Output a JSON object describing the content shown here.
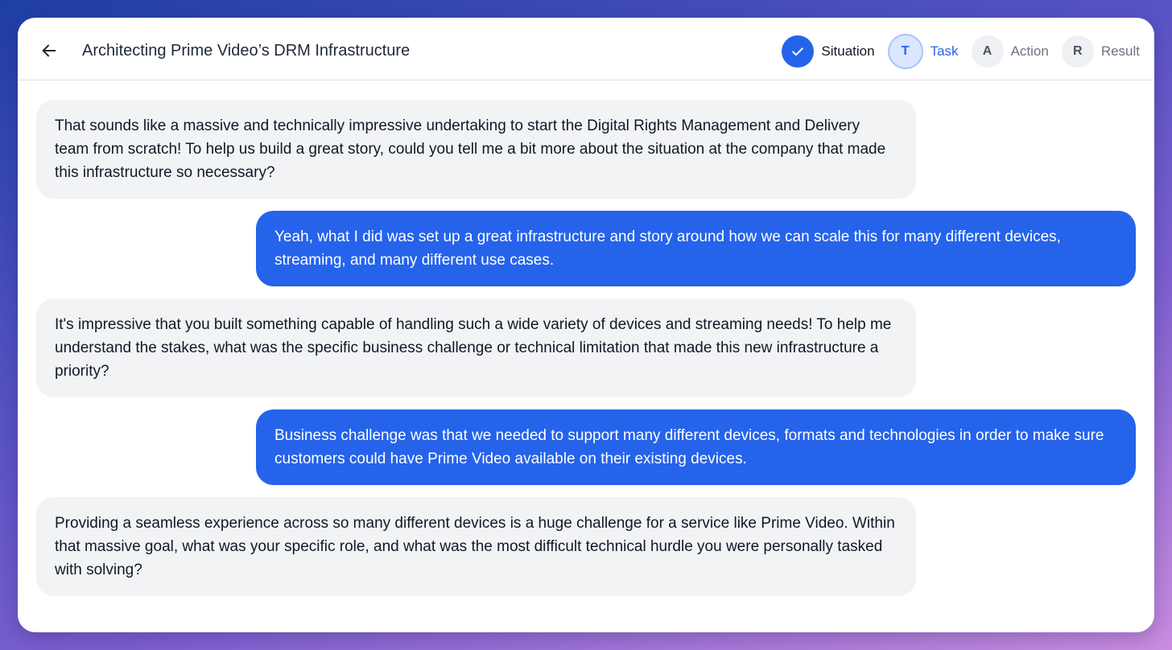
{
  "header": {
    "title": "Architecting Prime Video’s DRM Infrastructure",
    "back_icon": "arrow-left-icon"
  },
  "steps": [
    {
      "letter": "",
      "label": "Situation",
      "state": "done",
      "icon": "check-icon"
    },
    {
      "letter": "T",
      "label": "Task",
      "state": "active"
    },
    {
      "letter": "A",
      "label": "Action",
      "state": "pending"
    },
    {
      "letter": "R",
      "label": "Result",
      "state": "pending"
    }
  ],
  "colors": {
    "accent": "#2563eb",
    "ai_bubble": "#f2f3f5",
    "user_bubble": "#2563eb"
  },
  "messages": [
    {
      "role": "ai",
      "text": "That sounds like a massive and technically impressive undertaking to start the Digital Rights Management and Delivery team from scratch! To help us build a great story, could you tell me a bit more about the situation at the company that made this infrastructure so necessary?"
    },
    {
      "role": "user",
      "text": "Yeah, what I did was set up a great infrastructure and story around how we can scale this for many different devices, streaming, and many different use cases."
    },
    {
      "role": "ai",
      "text": "It's impressive that you built something capable of handling such a wide variety of devices and streaming needs! To help me understand the stakes, what was the specific business challenge or technical limitation that made this new infrastructure a priority?"
    },
    {
      "role": "user",
      "text": "Business challenge was that we needed to support many different devices, formats and technologies in order to make sure customers could have Prime Video available on their existing devices."
    },
    {
      "role": "ai",
      "text": "Providing a seamless experience across so many different devices is a huge challenge for a service like Prime Video. Within that massive goal, what was your specific role, and what was the most difficult technical hurdle you were personally tasked with solving?"
    }
  ]
}
